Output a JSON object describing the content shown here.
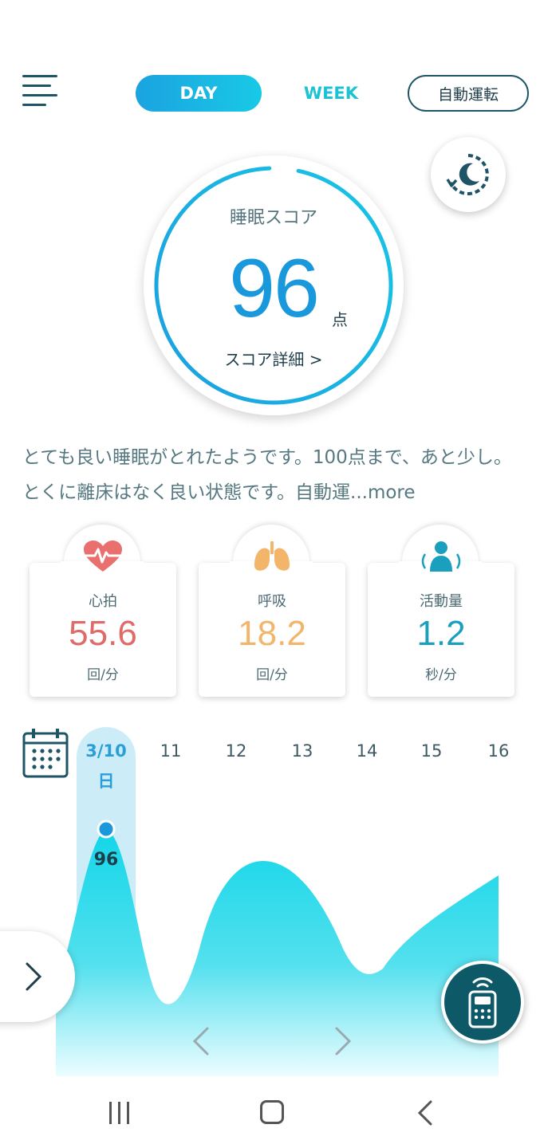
{
  "header": {
    "tab_day": "DAY",
    "tab_week": "WEEK",
    "auto_button": "自動運転"
  },
  "score": {
    "label": "睡眠スコア",
    "value": "96",
    "unit": "点",
    "detail_link": "スコア詳細 >",
    "progress": 0.96
  },
  "summary": {
    "text": "とても良い睡眠がとれたようです。100点まで、あと少し。とくに離床はなく良い状態です。自動運",
    "more": "...more"
  },
  "metrics": [
    {
      "label": "心拍",
      "value": "55.6",
      "unit": "回/分",
      "color": "#e06a68",
      "icon": "heart-pulse-icon"
    },
    {
      "label": "呼吸",
      "value": "18.2",
      "unit": "回/分",
      "color": "#f2b56a",
      "icon": "lungs-icon"
    },
    {
      "label": "活動量",
      "value": "1.2",
      "unit": "秒/分",
      "color": "#1a9fbf",
      "icon": "person-movement-icon"
    }
  ],
  "days": {
    "active_date": "3/10",
    "active_weekday": "日",
    "labels": [
      "11",
      "12",
      "13",
      "14",
      "15",
      "16"
    ],
    "active_score": "96"
  },
  "colors": {
    "accent": "#1a98dc",
    "teal": "#1cc3d2",
    "dark": "#1e5466",
    "remote_bg": "#0d5968"
  }
}
